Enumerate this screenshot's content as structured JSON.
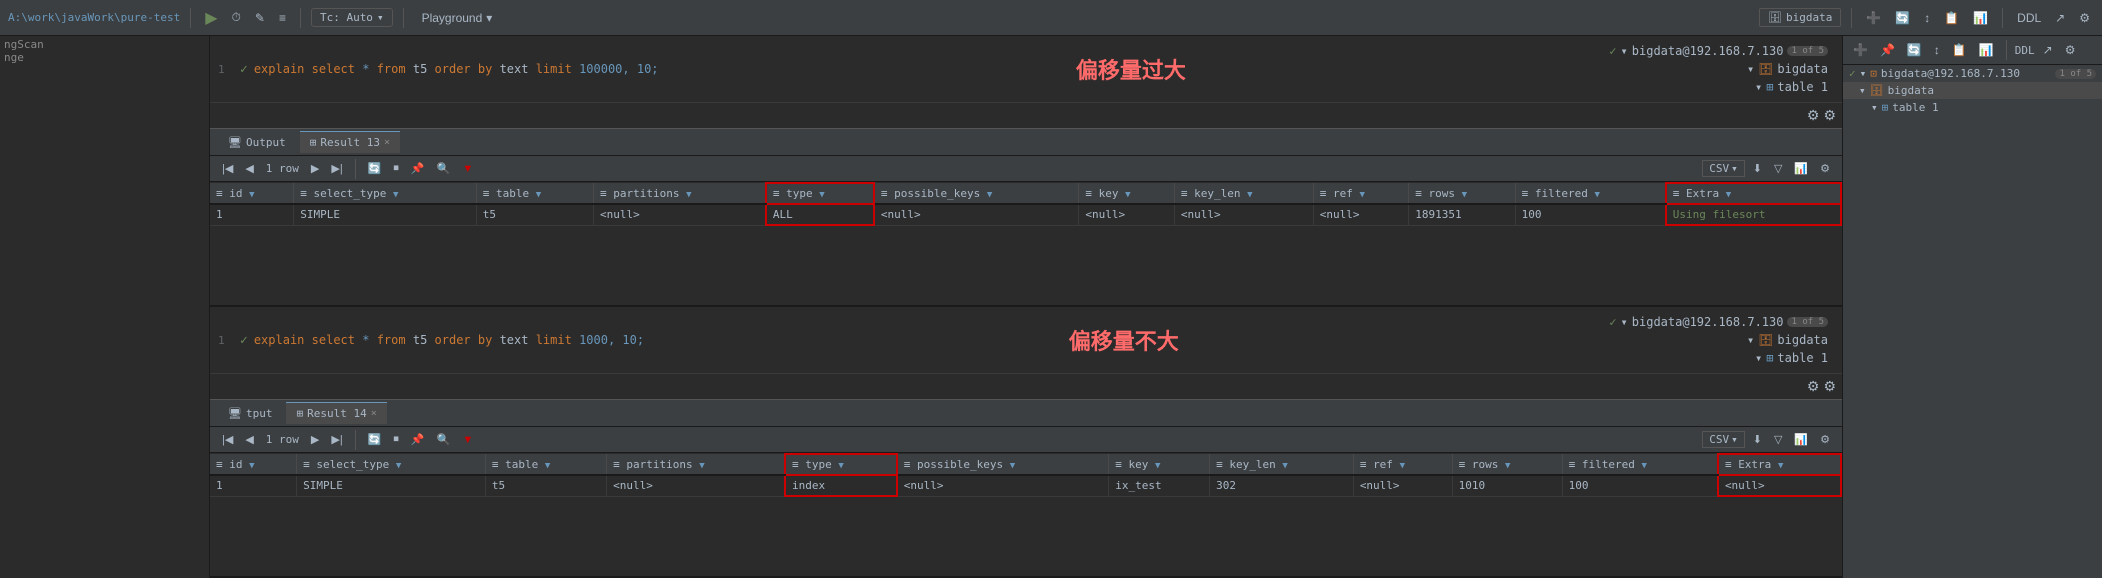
{
  "toolbar": {
    "path": "A:\\work\\javaWork\\pure-test",
    "play_btn": "▶",
    "tc_label": "Tc: Auto",
    "playground_label": "Playground",
    "ddl_label": "DDL",
    "db_selector": "bigdata",
    "icons": [
      "⏱",
      "✎",
      "≡",
      "↕",
      "🔄",
      "📋",
      "📊",
      "DDL",
      "⚙",
      "🔍"
    ]
  },
  "left_panel": {
    "text1": "ngScan",
    "text2": "nge"
  },
  "top_section": {
    "query_line": "1",
    "query_check": "✓",
    "query_sql": "explain select * from t5 order by text limit 100000, 10;",
    "annotation": "偏移量过大",
    "conn_host": "bigdata@192.168.7.130",
    "conn_badge": "1 of 5",
    "conn_db": "bigdata",
    "conn_table": "table 1"
  },
  "top_result": {
    "output_tab": "Output",
    "result_tab": "Result 13",
    "row_count": "1 row",
    "csv_label": "CSV",
    "columns": [
      {
        "name": "id",
        "has_filter": true
      },
      {
        "name": "select_type",
        "has_filter": true
      },
      {
        "name": "table",
        "has_filter": true
      },
      {
        "name": "partitions",
        "has_filter": true
      },
      {
        "name": "type",
        "has_filter": true,
        "highlight": true
      },
      {
        "name": "possible_keys",
        "has_filter": true
      },
      {
        "name": "key",
        "has_filter": true
      },
      {
        "name": "key_len",
        "has_filter": true
      },
      {
        "name": "ref",
        "has_filter": true
      },
      {
        "name": "rows",
        "has_filter": true
      },
      {
        "name": "filtered",
        "has_filter": true
      },
      {
        "name": "Extra",
        "has_filter": true
      }
    ],
    "rows": [
      [
        "1",
        "SIMPLE",
        "t5",
        "<null>",
        "ALL",
        "<null>",
        "<null>",
        "<null>",
        "<null>",
        "1891351",
        "100",
        "Using filesort"
      ]
    ]
  },
  "bottom_section": {
    "query_line": "1",
    "query_check": "✓",
    "query_sql": "explain select * from t5 order by text limit 1000, 10;",
    "annotation": "偏移量不大",
    "conn_host": "bigdata@192.168.7.130",
    "conn_badge": "1 of 5",
    "conn_db": "bigdata",
    "conn_table": "table 1"
  },
  "bottom_result": {
    "output_tab": "tput",
    "result_tab": "Result 14",
    "row_count": "1 row",
    "csv_label": "CSV",
    "columns": [
      {
        "name": "id",
        "has_filter": true
      },
      {
        "name": "select_type",
        "has_filter": true
      },
      {
        "name": "table",
        "has_filter": true
      },
      {
        "name": "partitions",
        "has_filter": true
      },
      {
        "name": "type",
        "has_filter": true,
        "highlight": true
      },
      {
        "name": "possible_keys",
        "has_filter": true
      },
      {
        "name": "key",
        "has_filter": true
      },
      {
        "name": "key_len",
        "has_filter": true
      },
      {
        "name": "ref",
        "has_filter": true
      },
      {
        "name": "rows",
        "has_filter": true
      },
      {
        "name": "filtered",
        "has_filter": true
      },
      {
        "name": "Extra",
        "has_filter": true
      }
    ],
    "rows": [
      [
        "1",
        "SIMPLE",
        "t5",
        "<null>",
        "index",
        "<null>",
        "ix_test",
        "302",
        "<null>",
        "1010",
        "100",
        "<null>"
      ]
    ]
  },
  "right_panel": {
    "connections": [
      {
        "label": "bigdata@192.168.7.130",
        "badge": "1 of 5",
        "status": "connected"
      },
      {
        "label": "bigdata",
        "indent": 1
      },
      {
        "label": "table 1",
        "indent": 2
      }
    ]
  }
}
